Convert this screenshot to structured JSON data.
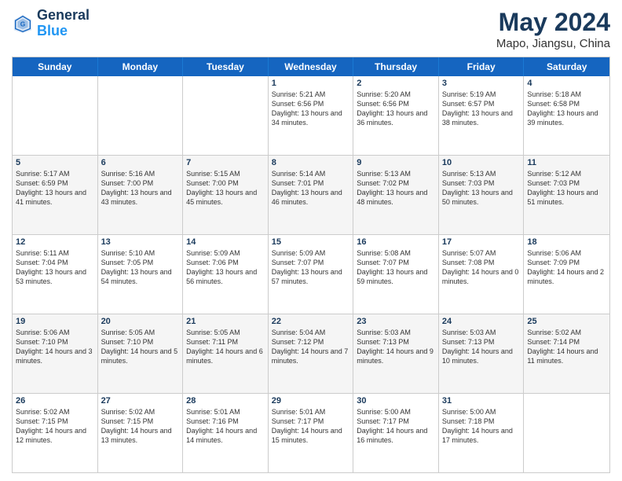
{
  "header": {
    "logo_line1": "General",
    "logo_line2": "Blue",
    "title": "May 2024",
    "subtitle": "Mapo, Jiangsu, China"
  },
  "days": [
    "Sunday",
    "Monday",
    "Tuesday",
    "Wednesday",
    "Thursday",
    "Friday",
    "Saturday"
  ],
  "rows": [
    [
      {
        "date": "",
        "info": ""
      },
      {
        "date": "",
        "info": ""
      },
      {
        "date": "",
        "info": ""
      },
      {
        "date": "1",
        "info": "Sunrise: 5:21 AM\nSunset: 6:56 PM\nDaylight: 13 hours and 34 minutes."
      },
      {
        "date": "2",
        "info": "Sunrise: 5:20 AM\nSunset: 6:56 PM\nDaylight: 13 hours and 36 minutes."
      },
      {
        "date": "3",
        "info": "Sunrise: 5:19 AM\nSunset: 6:57 PM\nDaylight: 13 hours and 38 minutes."
      },
      {
        "date": "4",
        "info": "Sunrise: 5:18 AM\nSunset: 6:58 PM\nDaylight: 13 hours and 39 minutes."
      }
    ],
    [
      {
        "date": "5",
        "info": "Sunrise: 5:17 AM\nSunset: 6:59 PM\nDaylight: 13 hours and 41 minutes."
      },
      {
        "date": "6",
        "info": "Sunrise: 5:16 AM\nSunset: 7:00 PM\nDaylight: 13 hours and 43 minutes."
      },
      {
        "date": "7",
        "info": "Sunrise: 5:15 AM\nSunset: 7:00 PM\nDaylight: 13 hours and 45 minutes."
      },
      {
        "date": "8",
        "info": "Sunrise: 5:14 AM\nSunset: 7:01 PM\nDaylight: 13 hours and 46 minutes."
      },
      {
        "date": "9",
        "info": "Sunrise: 5:13 AM\nSunset: 7:02 PM\nDaylight: 13 hours and 48 minutes."
      },
      {
        "date": "10",
        "info": "Sunrise: 5:13 AM\nSunset: 7:03 PM\nDaylight: 13 hours and 50 minutes."
      },
      {
        "date": "11",
        "info": "Sunrise: 5:12 AM\nSunset: 7:03 PM\nDaylight: 13 hours and 51 minutes."
      }
    ],
    [
      {
        "date": "12",
        "info": "Sunrise: 5:11 AM\nSunset: 7:04 PM\nDaylight: 13 hours and 53 minutes."
      },
      {
        "date": "13",
        "info": "Sunrise: 5:10 AM\nSunset: 7:05 PM\nDaylight: 13 hours and 54 minutes."
      },
      {
        "date": "14",
        "info": "Sunrise: 5:09 AM\nSunset: 7:06 PM\nDaylight: 13 hours and 56 minutes."
      },
      {
        "date": "15",
        "info": "Sunrise: 5:09 AM\nSunset: 7:07 PM\nDaylight: 13 hours and 57 minutes."
      },
      {
        "date": "16",
        "info": "Sunrise: 5:08 AM\nSunset: 7:07 PM\nDaylight: 13 hours and 59 minutes."
      },
      {
        "date": "17",
        "info": "Sunrise: 5:07 AM\nSunset: 7:08 PM\nDaylight: 14 hours and 0 minutes."
      },
      {
        "date": "18",
        "info": "Sunrise: 5:06 AM\nSunset: 7:09 PM\nDaylight: 14 hours and 2 minutes."
      }
    ],
    [
      {
        "date": "19",
        "info": "Sunrise: 5:06 AM\nSunset: 7:10 PM\nDaylight: 14 hours and 3 minutes."
      },
      {
        "date": "20",
        "info": "Sunrise: 5:05 AM\nSunset: 7:10 PM\nDaylight: 14 hours and 5 minutes."
      },
      {
        "date": "21",
        "info": "Sunrise: 5:05 AM\nSunset: 7:11 PM\nDaylight: 14 hours and 6 minutes."
      },
      {
        "date": "22",
        "info": "Sunrise: 5:04 AM\nSunset: 7:12 PM\nDaylight: 14 hours and 7 minutes."
      },
      {
        "date": "23",
        "info": "Sunrise: 5:03 AM\nSunset: 7:13 PM\nDaylight: 14 hours and 9 minutes."
      },
      {
        "date": "24",
        "info": "Sunrise: 5:03 AM\nSunset: 7:13 PM\nDaylight: 14 hours and 10 minutes."
      },
      {
        "date": "25",
        "info": "Sunrise: 5:02 AM\nSunset: 7:14 PM\nDaylight: 14 hours and 11 minutes."
      }
    ],
    [
      {
        "date": "26",
        "info": "Sunrise: 5:02 AM\nSunset: 7:15 PM\nDaylight: 14 hours and 12 minutes."
      },
      {
        "date": "27",
        "info": "Sunrise: 5:02 AM\nSunset: 7:15 PM\nDaylight: 14 hours and 13 minutes."
      },
      {
        "date": "28",
        "info": "Sunrise: 5:01 AM\nSunset: 7:16 PM\nDaylight: 14 hours and 14 minutes."
      },
      {
        "date": "29",
        "info": "Sunrise: 5:01 AM\nSunset: 7:17 PM\nDaylight: 14 hours and 15 minutes."
      },
      {
        "date": "30",
        "info": "Sunrise: 5:00 AM\nSunset: 7:17 PM\nDaylight: 14 hours and 16 minutes."
      },
      {
        "date": "31",
        "info": "Sunrise: 5:00 AM\nSunset: 7:18 PM\nDaylight: 14 hours and 17 minutes."
      },
      {
        "date": "",
        "info": ""
      }
    ]
  ]
}
